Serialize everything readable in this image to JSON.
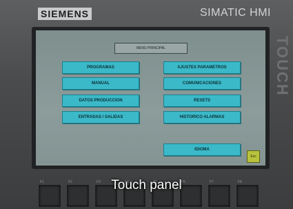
{
  "brand": "SIEMENS",
  "model": "SIMATIC HMI",
  "side_logo": "TOUCH",
  "screen": {
    "title": "MENU PRINCIPAL",
    "left_buttons": [
      "PROGRAMAS",
      "MANUAL",
      "DATOS PRODUCCION",
      "ENTRADAS / SALIDAS"
    ],
    "right_buttons": [
      "AJUSTES PARAMETROS",
      "COMUNICACIONES",
      "RESETS",
      "HISTORICO ALARMAS"
    ],
    "language_button": "IDIOMA",
    "esc_button": "Esc"
  },
  "function_keys": [
    "F1",
    "F2",
    "F3",
    "F4",
    "F5",
    "F6",
    "F7",
    "F8"
  ],
  "caption": "Touch panel",
  "colors": {
    "button": "#3bb9c8",
    "screen": "#849493",
    "esc": "#b8c23c"
  }
}
